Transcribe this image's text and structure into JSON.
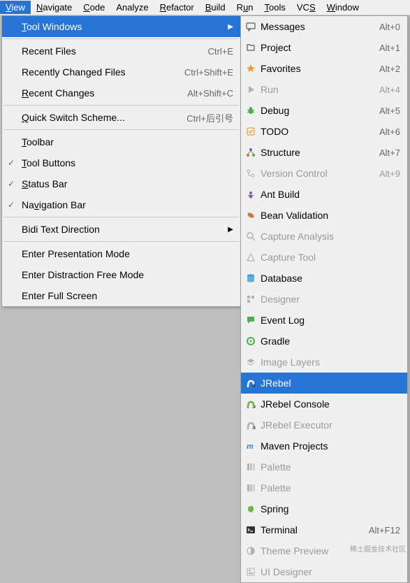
{
  "menubar": [
    {
      "label": "View",
      "mn": "V",
      "active": true
    },
    {
      "label": "Navigate",
      "mn": "N"
    },
    {
      "label": "Code",
      "mn": "C"
    },
    {
      "label": "Analyze",
      "mn": null
    },
    {
      "label": "Refactor",
      "mn": "R"
    },
    {
      "label": "Build",
      "mn": "B"
    },
    {
      "label": "Run",
      "mn": "u"
    },
    {
      "label": "Tools",
      "mn": "T"
    },
    {
      "label": "VCS",
      "mn": "S"
    },
    {
      "label": "Window",
      "mn": "W"
    }
  ],
  "view_menu": [
    {
      "type": "item",
      "label": "Tool Windows",
      "mn": "T",
      "submenu": true,
      "highlighted": true
    },
    {
      "type": "sep"
    },
    {
      "type": "item",
      "label": "Recent Files",
      "shortcut": "Ctrl+E"
    },
    {
      "type": "item",
      "label": "Recently Changed Files",
      "shortcut": "Ctrl+Shift+E"
    },
    {
      "type": "item",
      "label": "Recent Changes",
      "mn": "R",
      "shortcut": "Alt+Shift+C"
    },
    {
      "type": "sep"
    },
    {
      "type": "item",
      "label": "Quick Switch Scheme...",
      "mn": "Q",
      "shortcut": "Ctrl+后引号"
    },
    {
      "type": "sep"
    },
    {
      "type": "item",
      "label": "Toolbar",
      "mn": "T"
    },
    {
      "type": "item",
      "label": "Tool Buttons",
      "mn": "T",
      "checked": true
    },
    {
      "type": "item",
      "label": "Status Bar",
      "mn": "S",
      "checked": true
    },
    {
      "type": "item",
      "label": "Navigation Bar",
      "mn": "v",
      "checked": true
    },
    {
      "type": "sep"
    },
    {
      "type": "item",
      "label": "Bidi Text Direction",
      "submenu": true
    },
    {
      "type": "sep"
    },
    {
      "type": "item",
      "label": "Enter Presentation Mode"
    },
    {
      "type": "item",
      "label": "Enter Distraction Free Mode"
    },
    {
      "type": "item",
      "label": "Enter Full Screen"
    }
  ],
  "tool_windows": [
    {
      "label": "Messages",
      "shortcut": "Alt+0",
      "icon": "messages",
      "color": "#5b5b5b"
    },
    {
      "label": "Project",
      "shortcut": "Alt+1",
      "icon": "project",
      "color": "#5b5b5b"
    },
    {
      "label": "Favorites",
      "shortcut": "Alt+2",
      "icon": "star",
      "color": "#f0a030"
    },
    {
      "label": "Run",
      "shortcut": "Alt+4",
      "icon": "play",
      "color": "#b0b0b0",
      "disabled": true
    },
    {
      "label": "Debug",
      "shortcut": "Alt+5",
      "icon": "bug",
      "color": "#4caf50"
    },
    {
      "label": "TODO",
      "shortcut": "Alt+6",
      "icon": "todo",
      "color": "#f0a030"
    },
    {
      "label": "Structure",
      "shortcut": "Alt+7",
      "icon": "structure",
      "color": "#7b5ca8"
    },
    {
      "label": "Version Control",
      "shortcut": "Alt+9",
      "icon": "vcs",
      "color": "#b0b0b0",
      "disabled": true
    },
    {
      "label": "Ant Build",
      "icon": "ant",
      "color": "#7b5ca8"
    },
    {
      "label": "Bean Validation",
      "icon": "bean",
      "color": "#c77c3a"
    },
    {
      "label": "Capture Analysis",
      "icon": "search",
      "color": "#b0b0b0",
      "disabled": true
    },
    {
      "label": "Capture Tool",
      "icon": "capture",
      "color": "#b0b0b0",
      "disabled": true
    },
    {
      "label": "Database",
      "icon": "db",
      "color": "#3f9fd8"
    },
    {
      "label": "Designer",
      "icon": "designer",
      "color": "#b0b0b0",
      "disabled": true
    },
    {
      "label": "Event Log",
      "icon": "chat",
      "color": "#4caf50"
    },
    {
      "label": "Gradle",
      "icon": "gradle",
      "color": "#4caf50"
    },
    {
      "label": "Image Layers",
      "icon": "layers",
      "color": "#b0b0b0",
      "disabled": true
    },
    {
      "label": "JRebel",
      "icon": "jrebel",
      "color": "#6db33f",
      "highlighted": true
    },
    {
      "label": "JRebel Console",
      "icon": "jrebel",
      "color": "#6db33f"
    },
    {
      "label": "JRebel Executor",
      "icon": "jrebel",
      "color": "#b0b0b0",
      "disabled": true
    },
    {
      "label": "Maven Projects",
      "icon": "maven",
      "color": "#3f7fd8"
    },
    {
      "label": "Palette",
      "icon": "palette",
      "color": "#b0b0b0",
      "disabled": true
    },
    {
      "label": "Palette",
      "icon": "palette",
      "color": "#b0b0b0",
      "disabled": true
    },
    {
      "label": "Spring",
      "icon": "spring",
      "color": "#6db33f"
    },
    {
      "label": "Terminal",
      "shortcut": "Alt+F12",
      "icon": "terminal",
      "color": "#333"
    },
    {
      "label": "Theme Preview",
      "icon": "theme",
      "color": "#b0b0b0",
      "disabled": true
    },
    {
      "label": "UI Designer",
      "icon": "uidesigner",
      "color": "#b0b0b0",
      "disabled": true
    }
  ],
  "watermark": "稀土掘金技术社区"
}
